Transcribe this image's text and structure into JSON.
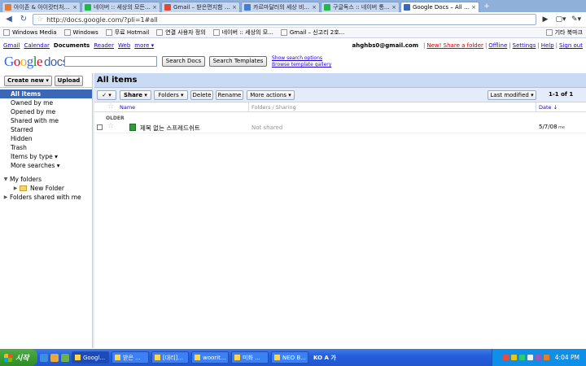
{
  "browser": {
    "tabs": [
      {
        "title": "아이존 & 아이캇터처 ...",
        "color": "#e07b3a"
      },
      {
        "title": "네이버 :: 세상의 모든 ...",
        "color": "#1fb84a"
      },
      {
        "title": "Gmail – 받은편지함 (9...",
        "color": "#d94b3c"
      },
      {
        "title": "카르마달러의 세상 비...",
        "color": "#4a7bd0"
      },
      {
        "title": "구글독스 :: 네이버 통...",
        "color": "#1fb84a"
      },
      {
        "title": "Google Docs – All items",
        "color": "#3a67b6",
        "active": true
      }
    ],
    "new_tab": "+",
    "back": "◀",
    "forward": "▶",
    "reload": "↻",
    "url": "http://docs.google.com/?pli=1#all",
    "go": "▶",
    "page_menu": "▢▾",
    "tools_menu": "✎▾",
    "bookmarks": [
      "Windows Media",
      "Windows",
      "무료 Hotmail",
      "연결 사용자 정의",
      "네이버 :: 세상의 모...",
      "Gmail – 신고리 2호..."
    ],
    "other_bookmarks": "기타 북마크"
  },
  "gbar": {
    "links": [
      "Gmail",
      "Calendar",
      "Documents",
      "Reader",
      "Web",
      "more ▾"
    ],
    "current": "Documents",
    "email": "ahghbs0@gmail.com",
    "right_links": [
      "New! Share a folder",
      "Offline",
      "Settings",
      "Help",
      "Sign out"
    ],
    "sep": "|"
  },
  "logo": {
    "google": "Google",
    "docs": "docs"
  },
  "search": {
    "search_docs": "Search Docs",
    "search_templates": "Search Templates",
    "show_options": "Show search options",
    "browse_gallery": "Browse template gallery"
  },
  "left": {
    "create_new": "Create new ▾",
    "upload": "Upload",
    "items": [
      "All items",
      "Owned by me",
      "Opened by me",
      "Shared with me",
      "Starred",
      "Hidden",
      "Trash",
      "Items by type ▾",
      "More searches ▾"
    ],
    "selected": "All items",
    "my_folders": "My folders",
    "new_folder": "New Folder",
    "shared_folders": "Folders shared with me"
  },
  "main": {
    "title": "All items",
    "actions": {
      "check": "✓ ▾",
      "share": "Share ▾",
      "folders": "Folders ▾",
      "delete": "Delete",
      "rename": "Rename",
      "more": "More actions ▾",
      "sort": "Last modified ▾"
    },
    "count": "1-1 of 1",
    "columns": {
      "name": "Name",
      "folders": "Folders / Sharing",
      "date": "Date ↓"
    },
    "group": "OLDER",
    "rows": [
      {
        "name": "제목 없는 스프레드쉬트",
        "sharing": "Not shared",
        "date": "5/7/08",
        "by": "me"
      }
    ]
  },
  "taskbar": {
    "start": "시작",
    "tasks": [
      "Googl...",
      "받은 ...",
      "[대리]...",
      "woorit...",
      "미화 ...",
      "NEO B..."
    ],
    "lang": "KO A 가",
    "time": "4:04 PM"
  }
}
